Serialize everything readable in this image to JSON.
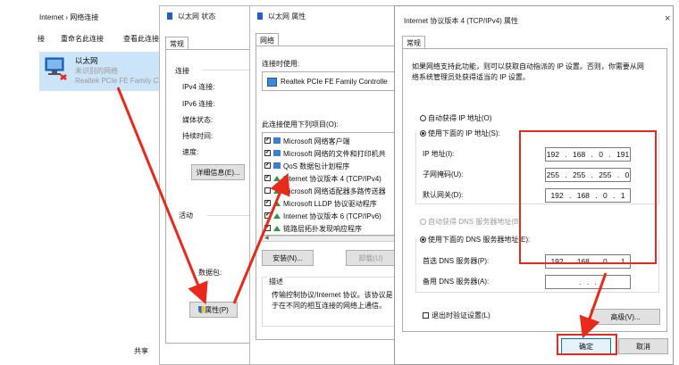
{
  "explorer": {
    "breadcrumb": "Internet  ›  网络连接",
    "toolbar": [
      "接",
      "重命名此连接",
      "查看此连接"
    ],
    "adapter": {
      "name": "以太网",
      "status": "未识别的网络",
      "device": "Realtek PCIe FE Family C"
    },
    "bottom_text": "共享"
  },
  "status_window": {
    "title": "以太网 状态",
    "tab": "常规",
    "section_conn": "连接",
    "rows": [
      "IPv4 连接:",
      "IPv6 连接:",
      "媒体状态:",
      "持续时间:",
      "速度:"
    ],
    "details_button": "详细信息(E)...",
    "section_activity": "活动",
    "packets_label": "数据包:",
    "properties_button": "属性(P)",
    "icon_color": "#1e62c8"
  },
  "props_window": {
    "title": "以太网 属性",
    "tab": "网络",
    "connect_using_label": "连接时使用:",
    "adapter_name": "Realtek PCIe FE Family Controlle",
    "items_label": "此连接使用下列项目(O):",
    "items": [
      {
        "label": "Microsoft 网络客户端",
        "checked": true
      },
      {
        "label": "Microsoft 网络的文件和打印机共",
        "checked": true
      },
      {
        "label": "QoS 数据包计划程序",
        "checked": true
      },
      {
        "label": "Internet 协议版本 4 (TCP/IPv4)",
        "checked": true
      },
      {
        "label": "Microsoft 网络适配器多路传送器",
        "checked": false
      },
      {
        "label": "Microsoft LLDP 协议驱动程序",
        "checked": true
      },
      {
        "label": "Internet 协议版本 6 (TCP/IPv6)",
        "checked": true
      },
      {
        "label": "链路层拓扑发现响应程序",
        "checked": true
      }
    ],
    "install_button": "安装(N)...",
    "uninstall_button": "卸载(U)",
    "description_label": "描述",
    "description_text_1": "传输控制协议/Internet 协议。该协议是",
    "description_text_2": "于在不同的相互连接的网络上通信。"
  },
  "ipv4_window": {
    "title": "Internet 协议版本 4 (TCP/IPv4) 属性",
    "close_glyph": "×",
    "tab": "常规",
    "intro_1": "如果网络支持此功能，则可以获取自动指派的 IP 设置。否则，你需要从网",
    "intro_2": "络系统管理员处获得适当的 IP 设置。",
    "auto_ip": "自动获得 IP 地址(O)",
    "manual_ip": "使用下面的 IP 地址(S):",
    "ip_label": "IP 地址(I):",
    "ip_value": "192 . 168 . 0 . 191",
    "mask_label": "子网掩码(U):",
    "mask_value": "255 . 255 . 255 . 0",
    "gateway_label": "默认网关(D):",
    "gateway_value": "192 . 168 . 0 . 1",
    "auto_dns": "自动获得 DNS 服务器地址(B)",
    "manual_dns": "使用下面的 DNS 服务器地址(E):",
    "dns1_label": "首选 DNS 服务器(P):",
    "dns1_value": "192 . 168 . 0 . 1",
    "dns2_label": "备用 DNS 服务器(A):",
    "dns2_value": ". . .",
    "validate_label": "退出时验证设置(L)",
    "advanced_button": "高级(V)...",
    "ok_button": "确定",
    "cancel_button": "取消"
  },
  "annotation_color": "#e8291c"
}
